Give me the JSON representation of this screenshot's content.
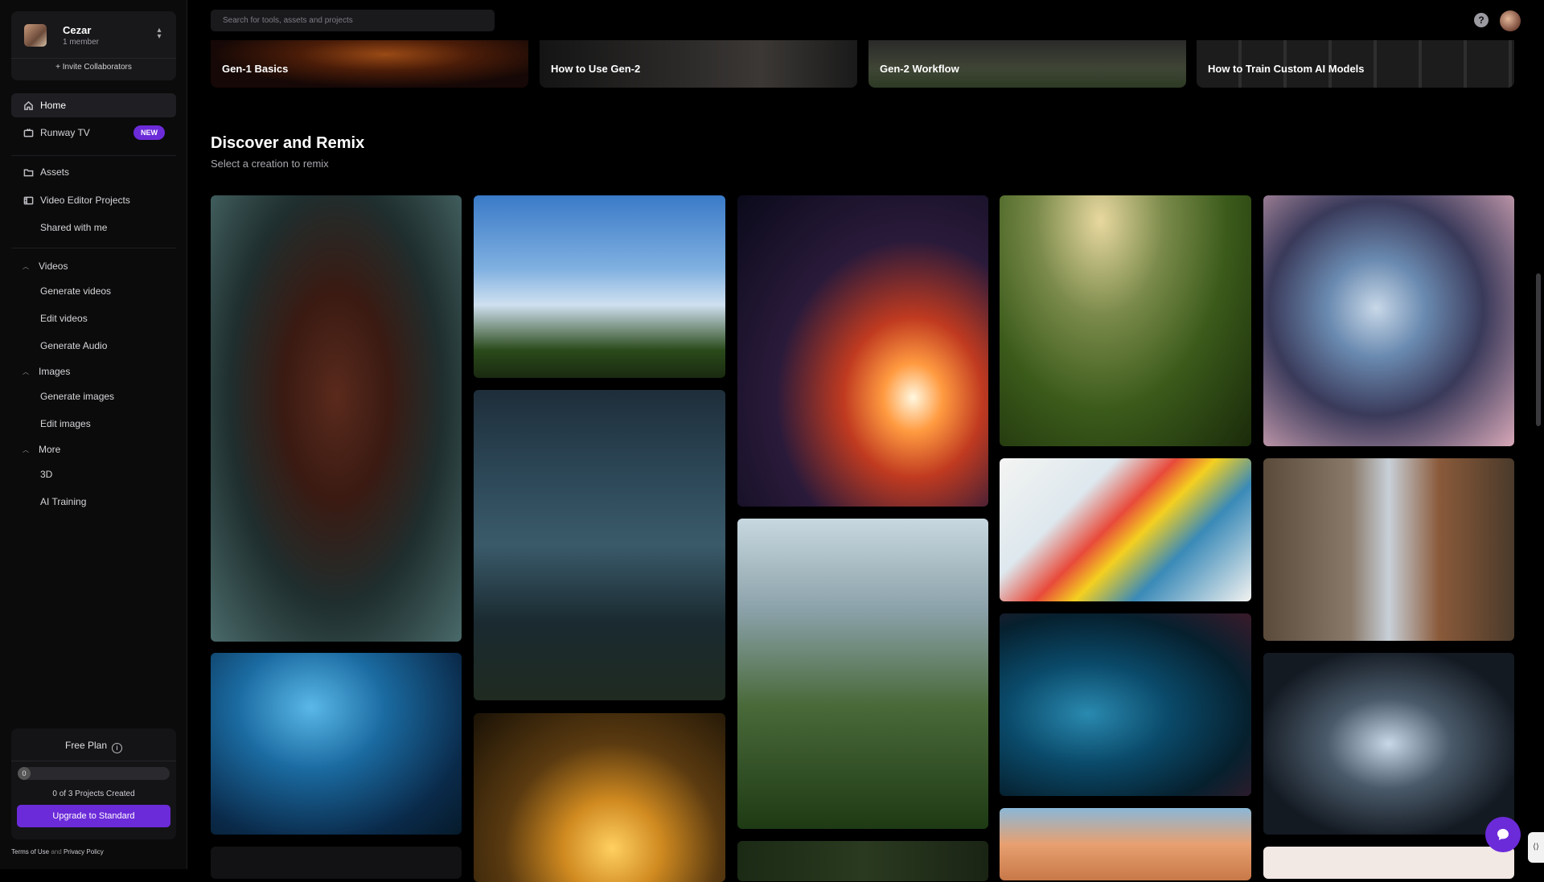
{
  "workspace": {
    "name": "Cezar",
    "members": "1 member",
    "invite_label": "+ Invite Collaborators"
  },
  "nav": {
    "home": "Home",
    "runway_tv": "Runway TV",
    "new_badge": "NEW",
    "assets": "Assets",
    "video_editor_projects": "Video Editor Projects",
    "shared_with_me": "Shared with me"
  },
  "sections": {
    "videos": {
      "label": "Videos",
      "items": [
        "Generate videos",
        "Edit videos",
        "Generate Audio"
      ]
    },
    "images": {
      "label": "Images",
      "items": [
        "Generate images",
        "Edit images"
      ]
    },
    "more": {
      "label": "More",
      "items": [
        "3D",
        "AI Training"
      ]
    }
  },
  "plan": {
    "title": "Free Plan",
    "progress_value": "0",
    "progress_fraction": 0,
    "projects_created": "0 of 3 Projects Created",
    "upgrade_label": "Upgrade to Standard"
  },
  "legal": {
    "terms": "Terms of Use",
    "and": "and",
    "privacy": "Privacy Policy"
  },
  "search": {
    "placeholder": "Search for tools, assets and projects"
  },
  "header": {
    "help_glyph": "?"
  },
  "tutorials": [
    {
      "label": "Gen-1 Basics"
    },
    {
      "label": "How to Use Gen-2"
    },
    {
      "label": "Gen-2 Workflow"
    },
    {
      "label": "How to Train Custom AI Models"
    }
  ],
  "discover": {
    "title": "Discover and Remix",
    "subtitle": "Select a creation to remix"
  },
  "gallery": [
    "hooded-figure",
    "palm-trees",
    "spaceship-explosion",
    "grass-closeup",
    "astronaut",
    "storm-clouds",
    "fluid-paint",
    "city-street",
    "jungle-city",
    "blue-particles",
    "underwater-reef",
    "crystals",
    "sunset-leaves",
    "desert-dune"
  ],
  "colors": {
    "accent": "#6c2bd9",
    "background": "#000000",
    "sidebar": "#0b0b0c"
  }
}
